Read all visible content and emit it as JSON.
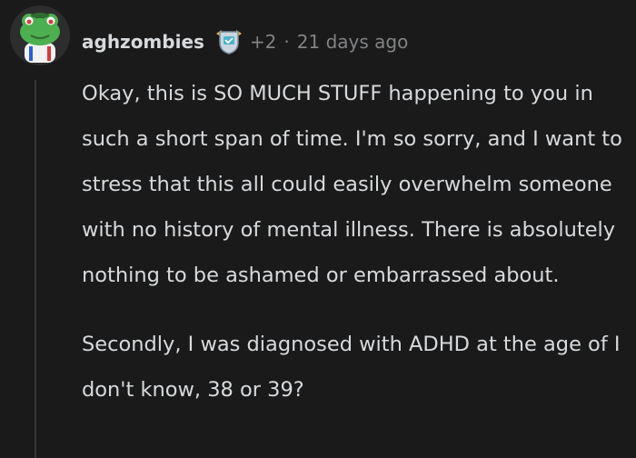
{
  "comment": {
    "username": "aghzombies",
    "karma": "+2",
    "separator": "·",
    "time": "21 days ago",
    "icons": {
      "avatar": "frog-avatar-icon",
      "flair": "shield-award-icon"
    },
    "paragraphs": [
      "Okay, this is SO MUCH STUFF happening to you in such a short span of time. I'm so sorry, and I want to stress that this all could easily overwhelm someone with no history of mental illness. There is absolutely nothing to be ashamed or embarrassed about.",
      "Secondly, I was diagnosed with ADHD at the age of I don't know, 38 or 39?"
    ]
  },
  "colors": {
    "background": "#1a1a1b",
    "text": "#d7dadc",
    "meta": "#818384",
    "thread_line": "#343536"
  }
}
